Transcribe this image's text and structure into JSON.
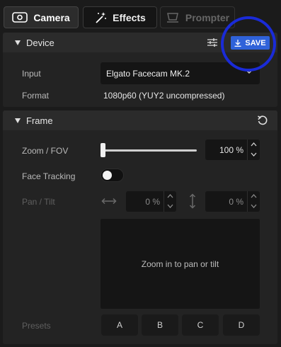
{
  "tabs": [
    {
      "label": "Camera",
      "icon": "camera-icon",
      "active": true
    },
    {
      "label": "Effects",
      "icon": "magic-wand-icon"
    },
    {
      "label": "Prompter",
      "icon": "prompter-icon",
      "disabled": true
    }
  ],
  "device": {
    "title": "Device",
    "save_label": "SAVE",
    "input_label": "Input",
    "input_value": "Elgato Facecam MK.2",
    "format_label": "Format",
    "format_value": "1080p60 (YUY2 uncompressed)"
  },
  "frame": {
    "title": "Frame",
    "zoom_label": "Zoom / FOV",
    "zoom_value": "100 %",
    "zoom_level_fraction": 0.0,
    "face_tracking_label": "Face Tracking",
    "face_tracking_on": false,
    "pan_tilt_label": "Pan / Tilt",
    "pan_value": "0 %",
    "tilt_value": "0 %",
    "preview_text": "Zoom in to pan or tilt",
    "presets_label": "Presets",
    "presets": [
      "A",
      "B",
      "C",
      "D"
    ]
  },
  "colors": {
    "accent": "#2f62d9",
    "highlight_ring": "#1a2bd8",
    "background": "#1b1b1b"
  }
}
